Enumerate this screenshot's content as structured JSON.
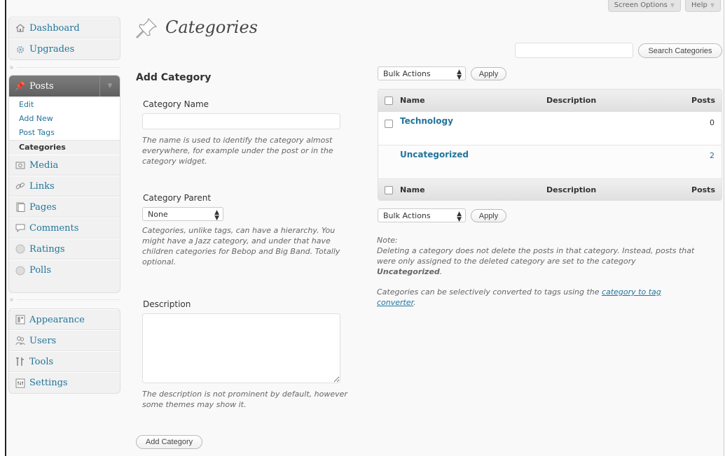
{
  "top": {
    "screen_options": "Screen Options",
    "help": "Help"
  },
  "sidebar": {
    "group1": [
      {
        "label": "Dashboard",
        "icon": "home-icon"
      },
      {
        "label": "Upgrades",
        "icon": "gear-icon"
      }
    ],
    "posts": {
      "label": "Posts",
      "icon": "pushpin-icon",
      "submenu": [
        "Edit",
        "Add New",
        "Post Tags",
        "Categories"
      ]
    },
    "group2": [
      {
        "label": "Media",
        "icon": "media-icon"
      },
      {
        "label": "Links",
        "icon": "link-icon"
      },
      {
        "label": "Pages",
        "icon": "pages-icon"
      },
      {
        "label": "Comments",
        "icon": "comment-icon"
      },
      {
        "label": "Ratings",
        "icon": "circle-icon"
      },
      {
        "label": "Polls",
        "icon": "circle-icon"
      }
    ],
    "group3": [
      {
        "label": "Appearance",
        "icon": "appearance-icon"
      },
      {
        "label": "Users",
        "icon": "users-icon"
      },
      {
        "label": "Tools",
        "icon": "tools-icon"
      },
      {
        "label": "Settings",
        "icon": "settings-icon"
      }
    ]
  },
  "page": {
    "title": "Categories"
  },
  "form": {
    "heading": "Add Category",
    "name_label": "Category Name",
    "name_value": "",
    "name_help": "The name is used to identify the category almost everywhere, for example under the post or in the category widget.",
    "parent_label": "Category Parent",
    "parent_value": "None",
    "parent_help": "Categories, unlike tags, can have a hierarchy. You might have a Jazz category, and under that have children categories for Bebop and Big Band. Totally optional.",
    "desc_label": "Description",
    "desc_value": "",
    "desc_help": "The description is not prominent by default, however some themes may show it.",
    "submit": "Add Category"
  },
  "list": {
    "search_value": "",
    "search_button": "Search Categories",
    "bulk_top": "Bulk Actions",
    "apply_top": "Apply",
    "bulk_bottom": "Bulk Actions",
    "apply_bottom": "Apply",
    "columns": {
      "name": "Name",
      "description": "Description",
      "posts": "Posts"
    },
    "rows": [
      {
        "name": "Technology",
        "description": "",
        "posts": "0"
      },
      {
        "name": "Uncategorized",
        "description": "",
        "posts": "2"
      }
    ]
  },
  "note": {
    "label": "Note:",
    "text_before": "Deleting a category does not delete the posts in that category. Instead, posts that were only assigned to the deleted category are set to the category ",
    "text_bold": "Uncategorized",
    "text_after": ".",
    "convert_before": "Categories can be selectively converted to tags using the ",
    "convert_link": "category to tag converter",
    "convert_after": "."
  },
  "colors": {
    "link": "#21759b",
    "menu_active": "#6d6d6d",
    "background": "#f9f9f9"
  }
}
